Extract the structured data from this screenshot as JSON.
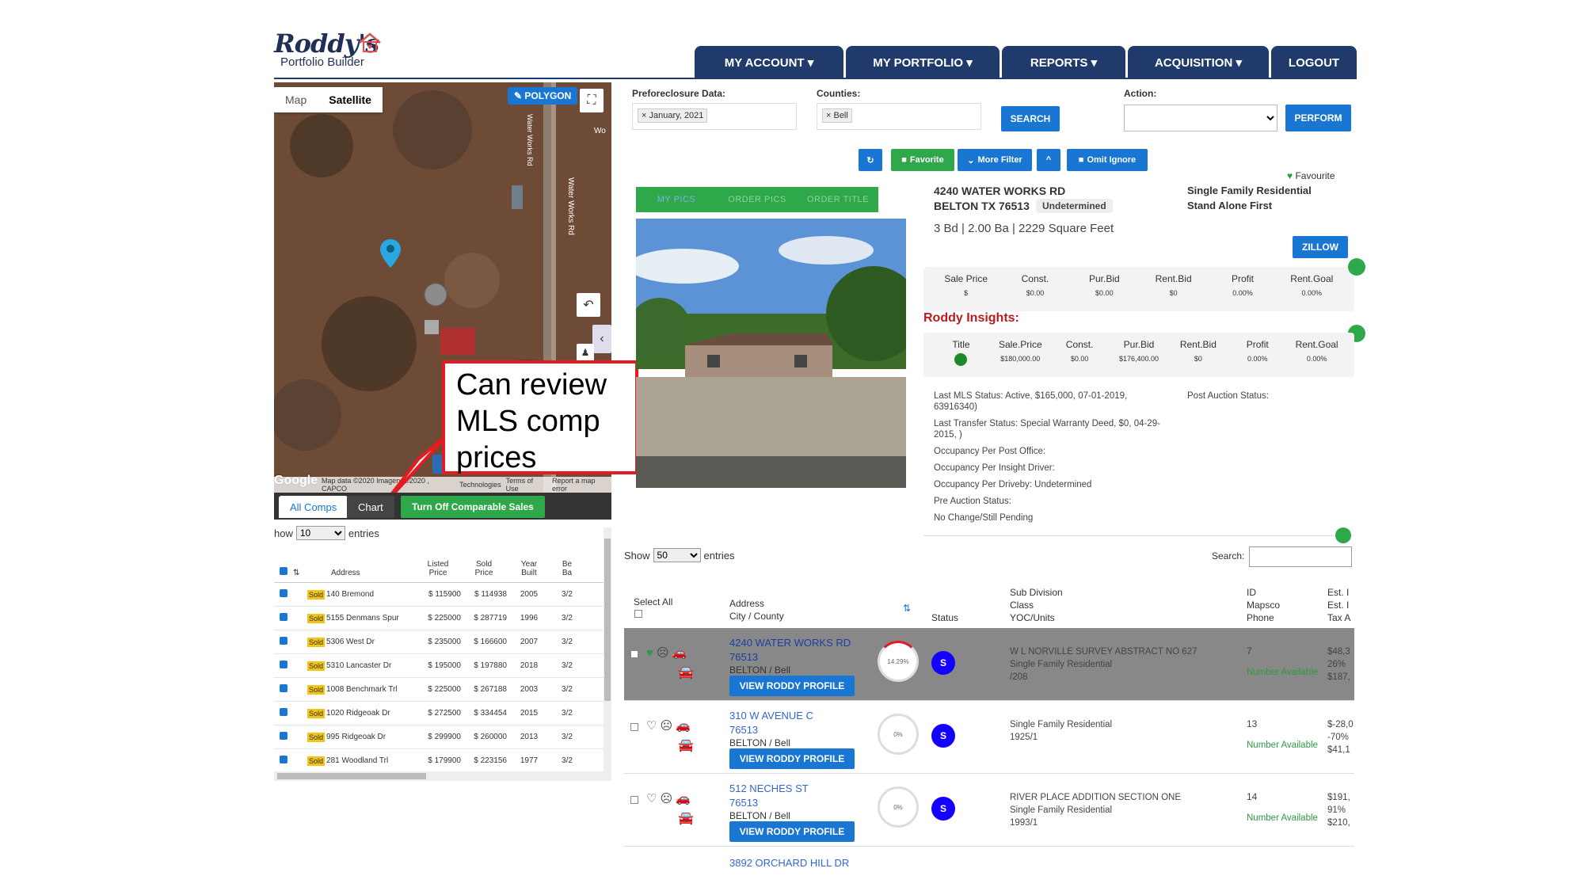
{
  "logo": {
    "script": "Roddy's",
    "sub": "Portfolio Builder"
  },
  "nav": [
    "MY ACCOUNT ▾",
    "MY PORTFOLIO ▾",
    "REPORTS ▾",
    "ACQUISITION ▾",
    "LOGOUT"
  ],
  "map": {
    "tab_map": "Map",
    "tab_satellite": "Satellite",
    "polygon": "POLYGON",
    "google": "Google",
    "footer": [
      "Map data ©2020 Imagery ©2020 , CAPCO",
      "Technologies",
      "Terms of Use",
      "Report a map error"
    ],
    "street_labels": [
      "Water Works Rd",
      "Water Works Rd",
      "Wo"
    ]
  },
  "callout": "Can review MLS comp prices",
  "comps": {
    "tab_all": "All Comps",
    "tab_chart": "Chart",
    "turn_off": "Turn Off Comparable Sales",
    "show_prefix": "how",
    "show_value": "10",
    "entries": "entries",
    "headers": {
      "address": "Address",
      "listed": [
        "Listed",
        "Price"
      ],
      "sold": [
        "Sold",
        "Price"
      ],
      "year": [
        "Year",
        "Built"
      ],
      "beds": [
        "Be",
        "Ba"
      ]
    },
    "rows": [
      {
        "status": "Sold",
        "address": "140 Bremond",
        "listed": "$ 115900",
        "sold": "$ 114938",
        "year": "2005",
        "bb": "3/2"
      },
      {
        "status": "Sold",
        "address": "5155 Denmans Spur",
        "listed": "$ 225000",
        "sold": "$ 287719",
        "year": "1996",
        "bb": "3/2"
      },
      {
        "status": "Sold",
        "address": "5306 West Dr",
        "listed": "$ 235000",
        "sold": "$ 166600",
        "year": "2007",
        "bb": "3/2"
      },
      {
        "status": "Sold",
        "address": "5310 Lancaster Dr",
        "listed": "$ 195000",
        "sold": "$ 197880",
        "year": "2018",
        "bb": "3/2"
      },
      {
        "status": "Sold",
        "address": "1008 Benchmark Trl",
        "listed": "$ 225000",
        "sold": "$ 267188",
        "year": "2003",
        "bb": "3/2"
      },
      {
        "status": "Sold",
        "address": "1020 Ridgeoak Dr",
        "listed": "$ 272500",
        "sold": "$ 334454",
        "year": "2015",
        "bb": "3/2"
      },
      {
        "status": "Sold",
        "address": "995 Ridgeoak Dr",
        "listed": "$ 299900",
        "sold": "$ 260000",
        "year": "2013",
        "bb": "3/2"
      },
      {
        "status": "Sold",
        "address": "281 Woodland Trl",
        "listed": "$ 179900",
        "sold": "$ 223156",
        "year": "1977",
        "bb": "3/2"
      }
    ]
  },
  "filters": {
    "preforeclosure_label": "Preforeclosure Data:",
    "preforeclosure_chip": "× January, 2021",
    "counties_label": "Counties:",
    "counties_chip": "× Bell",
    "search": "SEARCH",
    "action_label": "Action:",
    "perform": "PERFORM"
  },
  "toolbar": {
    "refresh": "↻",
    "favorite": "Favorite",
    "more_filter": "More Filter",
    "up": "^",
    "omit_ignore": "Omit Ignore"
  },
  "photo_tabs": [
    "MY PICS",
    "ORDER PICS",
    "ORDER TITLE"
  ],
  "property": {
    "line1": "4240 WATER WORKS RD",
    "line2": "BELTON TX 76513",
    "badge": "Undetermined",
    "bdba": "3 Bd | 2.00 Ba | 2229 Square Feet",
    "type1": "Single Family Residential",
    "type2": "Stand Alone First",
    "favourite": "Favourite",
    "zillow": "ZILLOW"
  },
  "metrics": [
    {
      "label": "Sale Price",
      "value": "$"
    },
    {
      "label": "Const.",
      "value": "$0.00"
    },
    {
      "label": "Pur.Bid",
      "value": "$0.00"
    },
    {
      "label": "Rent.Bid",
      "value": "$0"
    },
    {
      "label": "Profit",
      "value": "0.00%"
    },
    {
      "label": "Rent.Goal",
      "value": "0.00%"
    }
  ],
  "insights_title": "Roddy Insights:",
  "insights": [
    {
      "label": "Title",
      "value": ""
    },
    {
      "label": "Sale.Price",
      "value": "$180,000.00"
    },
    {
      "label": "Const.",
      "value": "$0.00"
    },
    {
      "label": "Pur.Bid",
      "value": "$176,400.00"
    },
    {
      "label": "Rent.Bid",
      "value": "$0"
    },
    {
      "label": "Profit",
      "value": "0.00%"
    },
    {
      "label": "Rent.Goal",
      "value": "0.00%"
    }
  ],
  "statuses": [
    "Last MLS Status: Active, $165,000, 07-01-2019, 63916340)",
    "Last Transfer Status: Special Warranty Deed, $0, 04-29-2015, )",
    "Occupancy Per Post Office:",
    "Occupancy Per Insight Driver:",
    "Occupancy Per Driveby: Undetermined",
    "Pre Auction Status:",
    "No Change/Still Pending"
  ],
  "post_auction": "Post Auction Status:",
  "results": {
    "show_label": "Show",
    "show_value": "50",
    "entries": "entries",
    "search_label": "Search:",
    "headers": {
      "select_all": "Select All",
      "address": "Address",
      "city": "City / County",
      "status": "Status",
      "subdiv": [
        "Sub Division",
        "Class",
        "YOC/Units"
      ],
      "id": [
        "ID",
        "Mapsco",
        "Phone"
      ],
      "est": [
        "Est. I",
        "Est. I",
        "Tax A"
      ]
    },
    "rows": [
      {
        "addr": "4240 WATER WORKS RD",
        "zip": "76513",
        "city": "BELTON / Bell",
        "pct": "14.29%",
        "status": "S",
        "subdiv": [
          "W L NORVILLE SURVEY ABSTRACT NO 627",
          "Single Family Residential",
          "/208"
        ],
        "id": "7",
        "phone": "Number Available",
        "est": [
          "$48,3",
          "26%",
          "$187,"
        ],
        "btn": "VIEW RODDY PROFILE"
      },
      {
        "addr": "310 W AVENUE C",
        "zip": "76513",
        "city": "BELTON / Bell",
        "pct": "0%",
        "status": "S",
        "subdiv": [
          "",
          "Single Family Residential",
          "1925/1"
        ],
        "id": "13",
        "phone": "Number Available",
        "est": [
          "$-28,0",
          "-70%",
          "$41,1"
        ],
        "btn": "VIEW RODDY PROFILE"
      },
      {
        "addr": "512 NECHES ST",
        "zip": "76513",
        "city": "BELTON / Bell",
        "pct": "0%",
        "status": "S",
        "subdiv": [
          "RIVER PLACE ADDITION SECTION ONE",
          "Single Family Residential",
          "1993/1"
        ],
        "id": "14",
        "phone": "Number Available",
        "est": [
          "$191,",
          "91%",
          "$210,"
        ],
        "btn": "VIEW RODDY PROFILE"
      }
    ],
    "partial_row": "3892 ORCHARD HILL DR"
  }
}
